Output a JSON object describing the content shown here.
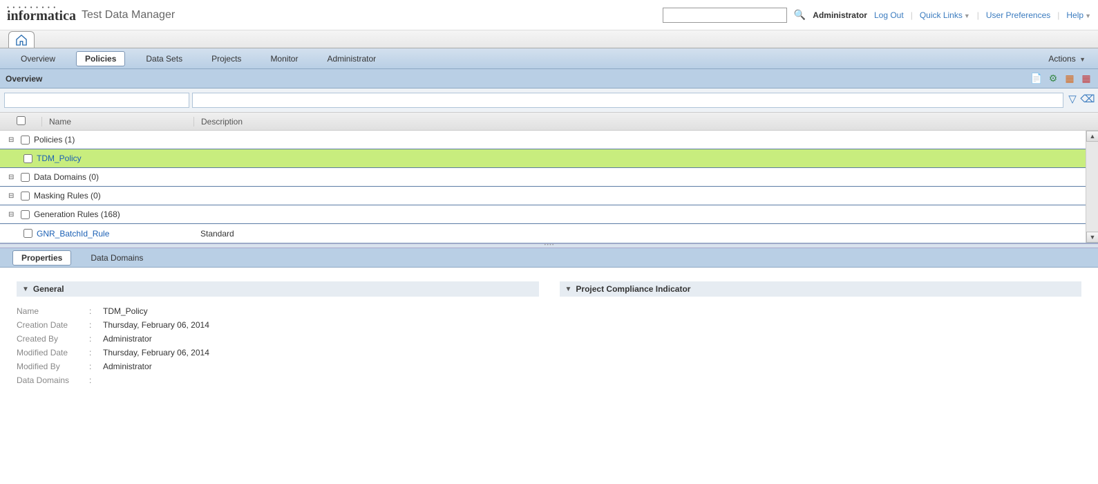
{
  "header": {
    "logo_text": "informatica",
    "app_name": "Test Data Manager",
    "admin_label": "Administrator",
    "logout": "Log Out",
    "quick_links": "Quick Links",
    "user_prefs": "User Preferences",
    "help": "Help"
  },
  "nav": {
    "overview": "Overview",
    "policies": "Policies",
    "data_sets": "Data Sets",
    "projects": "Projects",
    "monitor": "Monitor",
    "administrator": "Administrator",
    "actions": "Actions"
  },
  "panel": {
    "title": "Overview",
    "col_name": "Name",
    "col_desc": "Description"
  },
  "tree": {
    "policies_group": "Policies (1)",
    "tdm_policy": "TDM_Policy",
    "data_domains_group": "Data Domains (0)",
    "masking_rules_group": "Masking Rules (0)",
    "generation_rules_group": "Generation Rules (168)",
    "gnr_rule": "GNR_BatchId_Rule",
    "gnr_desc": "Standard"
  },
  "detail_tabs": {
    "properties": "Properties",
    "data_domains": "Data Domains"
  },
  "sections": {
    "general": "General",
    "compliance": "Project Compliance Indicator"
  },
  "props": {
    "name_label": "Name",
    "name_value": "TDM_Policy",
    "creation_label": "Creation Date",
    "creation_value": "Thursday, February 06, 2014",
    "created_by_label": "Created By",
    "created_by_value": "Administrator",
    "modified_date_label": "Modified Date",
    "modified_date_value": "Thursday, February 06, 2014",
    "modified_by_label": "Modified By",
    "modified_by_value": "Administrator",
    "data_domains_label": "Data Domains"
  }
}
